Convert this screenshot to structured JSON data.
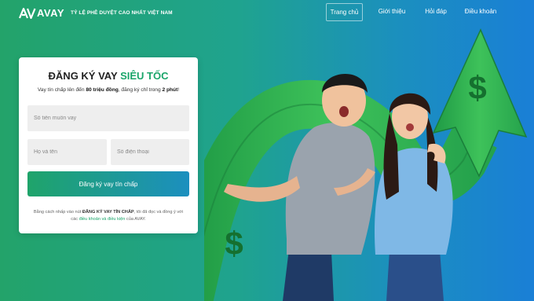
{
  "brand": {
    "name": "AVAY",
    "tagline": "TỶ LỆ PHÊ DUYỆT CAO NHẤT VIỆT NAM"
  },
  "nav": {
    "items": [
      {
        "label": "Trang chủ",
        "active": true
      },
      {
        "label": "Giới thiệu",
        "active": false
      },
      {
        "label": "Hỏi đáp",
        "active": false
      },
      {
        "label": "Điều khoản",
        "active": false
      }
    ]
  },
  "form": {
    "title_prefix": "ĐĂNG KÝ VAY",
    "title_highlight": "SIÊU TỐC",
    "subtitle": {
      "part1": "Vay tín chấp lên đến",
      "amount": "80 triệu đồng",
      "part2": ", đăng ký chỉ trong",
      "time": "2 phút",
      "part3": "!"
    },
    "amount_placeholder": "Số tiền muốn vay",
    "name_placeholder": "Họ và tên",
    "phone_placeholder": "Số điện thoại",
    "submit_label": "Đăng ký vay tín chấp",
    "disclaimer": {
      "part1": "Bằng cách nhấp vào nút",
      "button_ref": "ĐĂNG KÝ VAY TÍN CHẤP",
      "part2": ", tôi đã đọc và đồng ý với các",
      "link": "điều khoản và điều kiện",
      "part3": "của AVAY."
    }
  },
  "colors": {
    "brand_green": "#1aa56a",
    "brand_blue": "#1a7fd6",
    "money_green": "#2fb34a"
  },
  "illustration": {
    "icons": [
      "dollar-sign",
      "dollar-sign"
    ],
    "symbol": "$"
  }
}
